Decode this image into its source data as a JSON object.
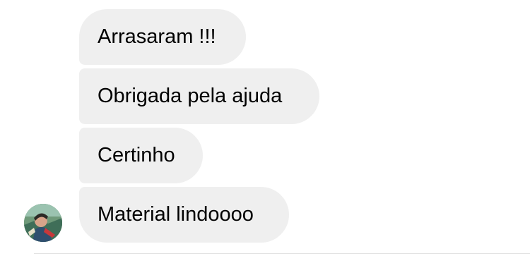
{
  "messages": [
    {
      "text": "Arrasaram !!!"
    },
    {
      "text": "Obrigada pela ajuda"
    },
    {
      "text": "Certinho"
    },
    {
      "text": "Material lindoooo"
    }
  ],
  "sender": {
    "avatar_icon": "profile-photo"
  },
  "colors": {
    "bubble_bg": "#efefef",
    "text": "#000000",
    "background": "#ffffff"
  }
}
